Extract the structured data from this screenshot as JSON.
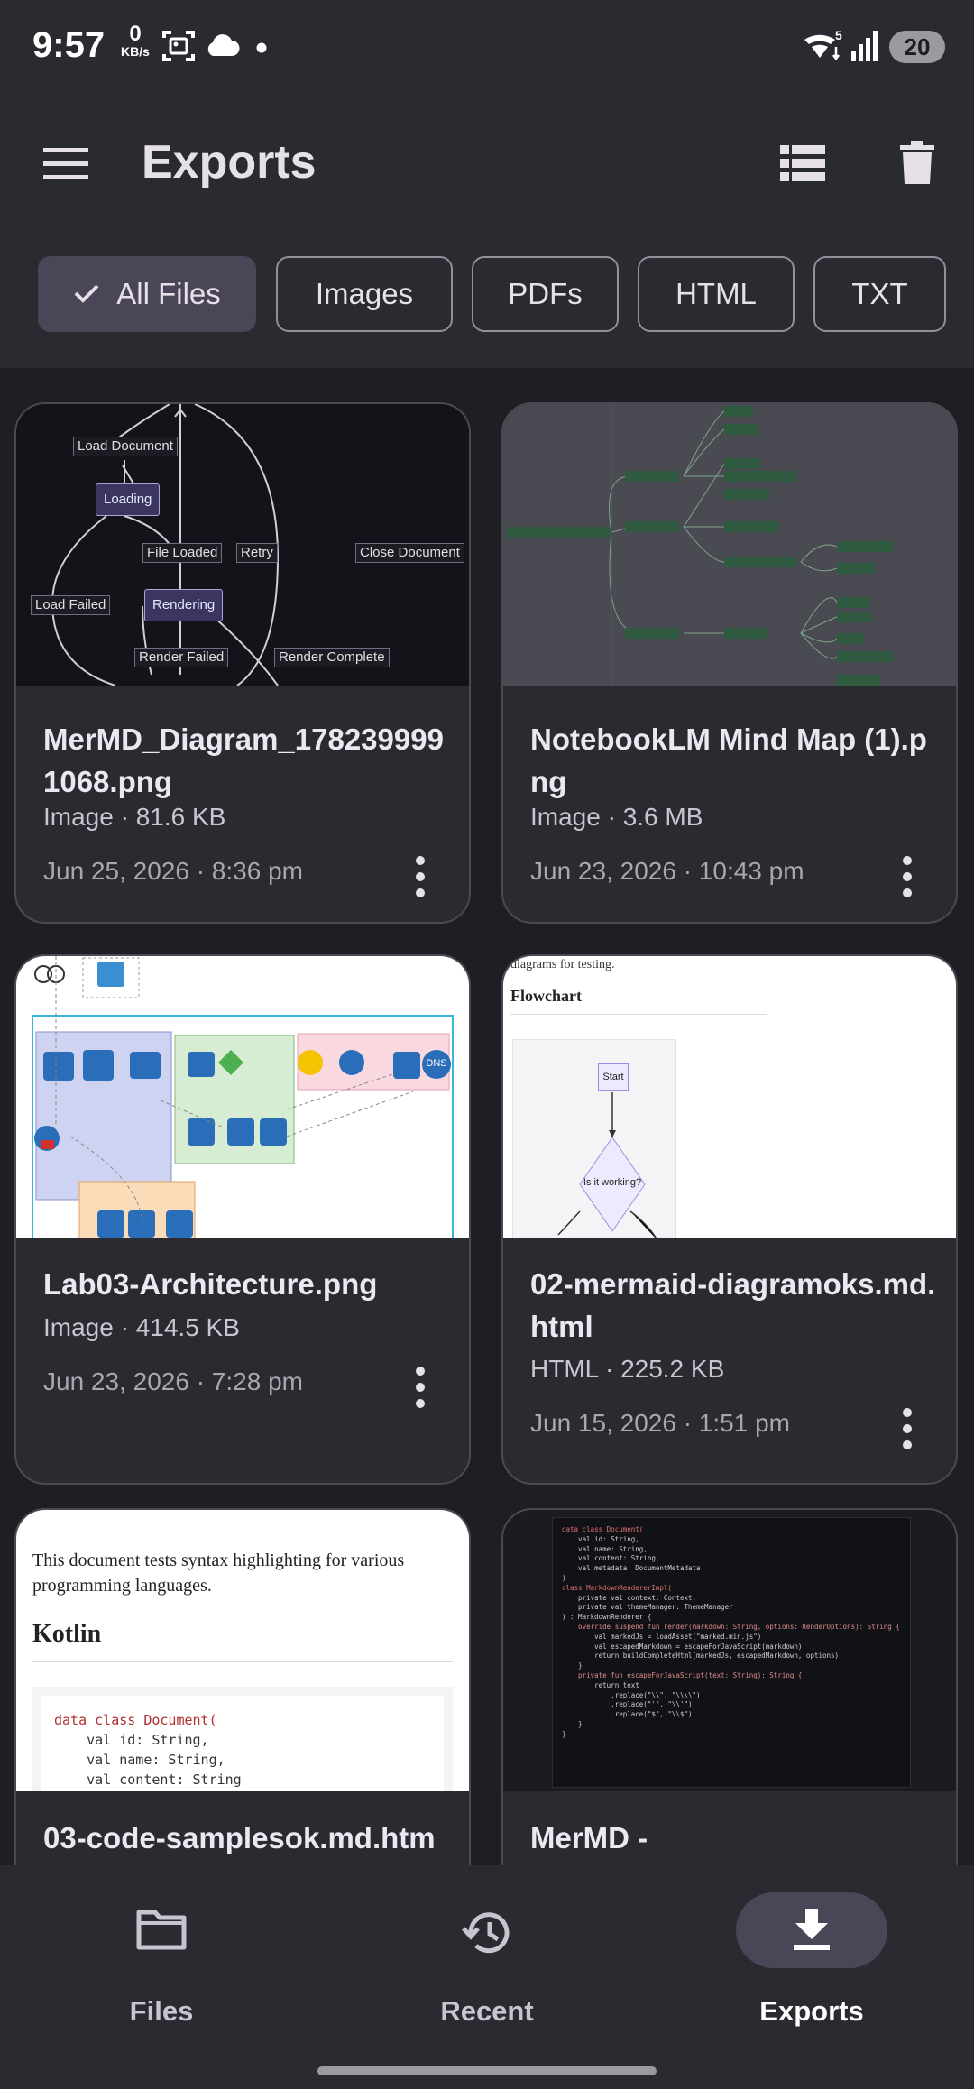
{
  "status_bar": {
    "time": "9:57",
    "net_speed_value": "0",
    "net_speed_unit": "KB/s",
    "wifi_badge": "5",
    "battery": "20"
  },
  "app_bar": {
    "title": "Exports"
  },
  "filters": {
    "chips": [
      "All Files",
      "Images",
      "PDFs",
      "HTML",
      "TXT"
    ],
    "selected": "All Files"
  },
  "files": [
    {
      "name": "MerMD_Diagram_1782399991068.png",
      "meta": "Image · 81.6 KB",
      "date": "Jun 25, 2026 · 8:36 pm",
      "thumbnail": {
        "nodes": [
          "Loading",
          "Rendering"
        ],
        "edge_labels": [
          "Load Document",
          "File Loaded",
          "Retry",
          "Close Document",
          "Load Failed",
          "Render Failed",
          "Render Complete"
        ]
      }
    },
    {
      "name": "NotebookLM Mind Map (1).png",
      "meta": "Image · 3.6 MB",
      "date": "Jun 23, 2026 · 10:43 pm"
    },
    {
      "name": "Lab03-Architecture.png",
      "meta": "Image · 414.5 KB",
      "date": "Jun 23, 2026 · 7:28 pm",
      "thumbnail": {
        "labels": [
          "DNS"
        ]
      }
    },
    {
      "name": "02-mermaid-diagramoks.md.html",
      "meta": "HTML · 225.2 KB",
      "date": "Jun 15, 2026 · 1:51 pm",
      "thumbnail": {
        "intro": "diagrams for testing.",
        "heading": "Flowchart",
        "start_node": "Start",
        "decision_node": "Is it working?"
      }
    },
    {
      "name": "03-code-samplesok.md.htm",
      "meta": "",
      "date": "",
      "thumbnail": {
        "intro": "This document tests syntax highlighting for various programming languages.",
        "heading": "Kotlin",
        "code": [
          "data class Document(",
          "    val id: String,",
          "    val name: String,",
          "    val content: String"
        ]
      }
    },
    {
      "name": "MerMD -",
      "meta": "",
      "date": "",
      "thumbnail": {
        "code": [
          "data class Document(",
          "    val id: String,",
          "    val name: String,",
          "    val content: String,",
          "    val metadata: DocumentMetadata",
          ")",
          "",
          "class MarkdownRendererImpl(",
          "    private val context: Context,",
          "    private val themeManager: ThemeManager",
          ") : MarkdownRenderer {",
          "",
          "    override suspend fun render(markdown: String, options: RenderOptions): String {",
          "        val markedJs = loadAsset(\"marked.min.js\")",
          "        val escapedMarkdown = escapeForJavaScript(markdown)",
          "        return buildCompleteHtml(markedJs, escapedMarkdown, options)",
          "    }",
          "",
          "    private fun escapeForJavaScript(text: String): String {",
          "        return text",
          "            .replace(\"\\\\\", \"\\\\\\\\\")",
          "            .replace(\"'\", \"\\\\'\")",
          "            .replace(\"$\", \"\\\\$\")",
          "    }",
          "}"
        ]
      }
    }
  ],
  "bottom_nav": {
    "items": [
      "Files",
      "Recent",
      "Exports"
    ],
    "active": "Exports"
  },
  "colors": {
    "background": "#1e1e24",
    "surface": "#2a2a31",
    "selected_chip": "#4a4658",
    "outline": "#918f9a"
  },
  "icons": [
    "menu-icon",
    "list-view-icon",
    "delete-icon",
    "check-icon",
    "more-vert-icon",
    "folder-icon",
    "history-icon",
    "download-icon",
    "wifi-icon",
    "signal-icon",
    "screenshot-icon",
    "cloud-icon"
  ]
}
